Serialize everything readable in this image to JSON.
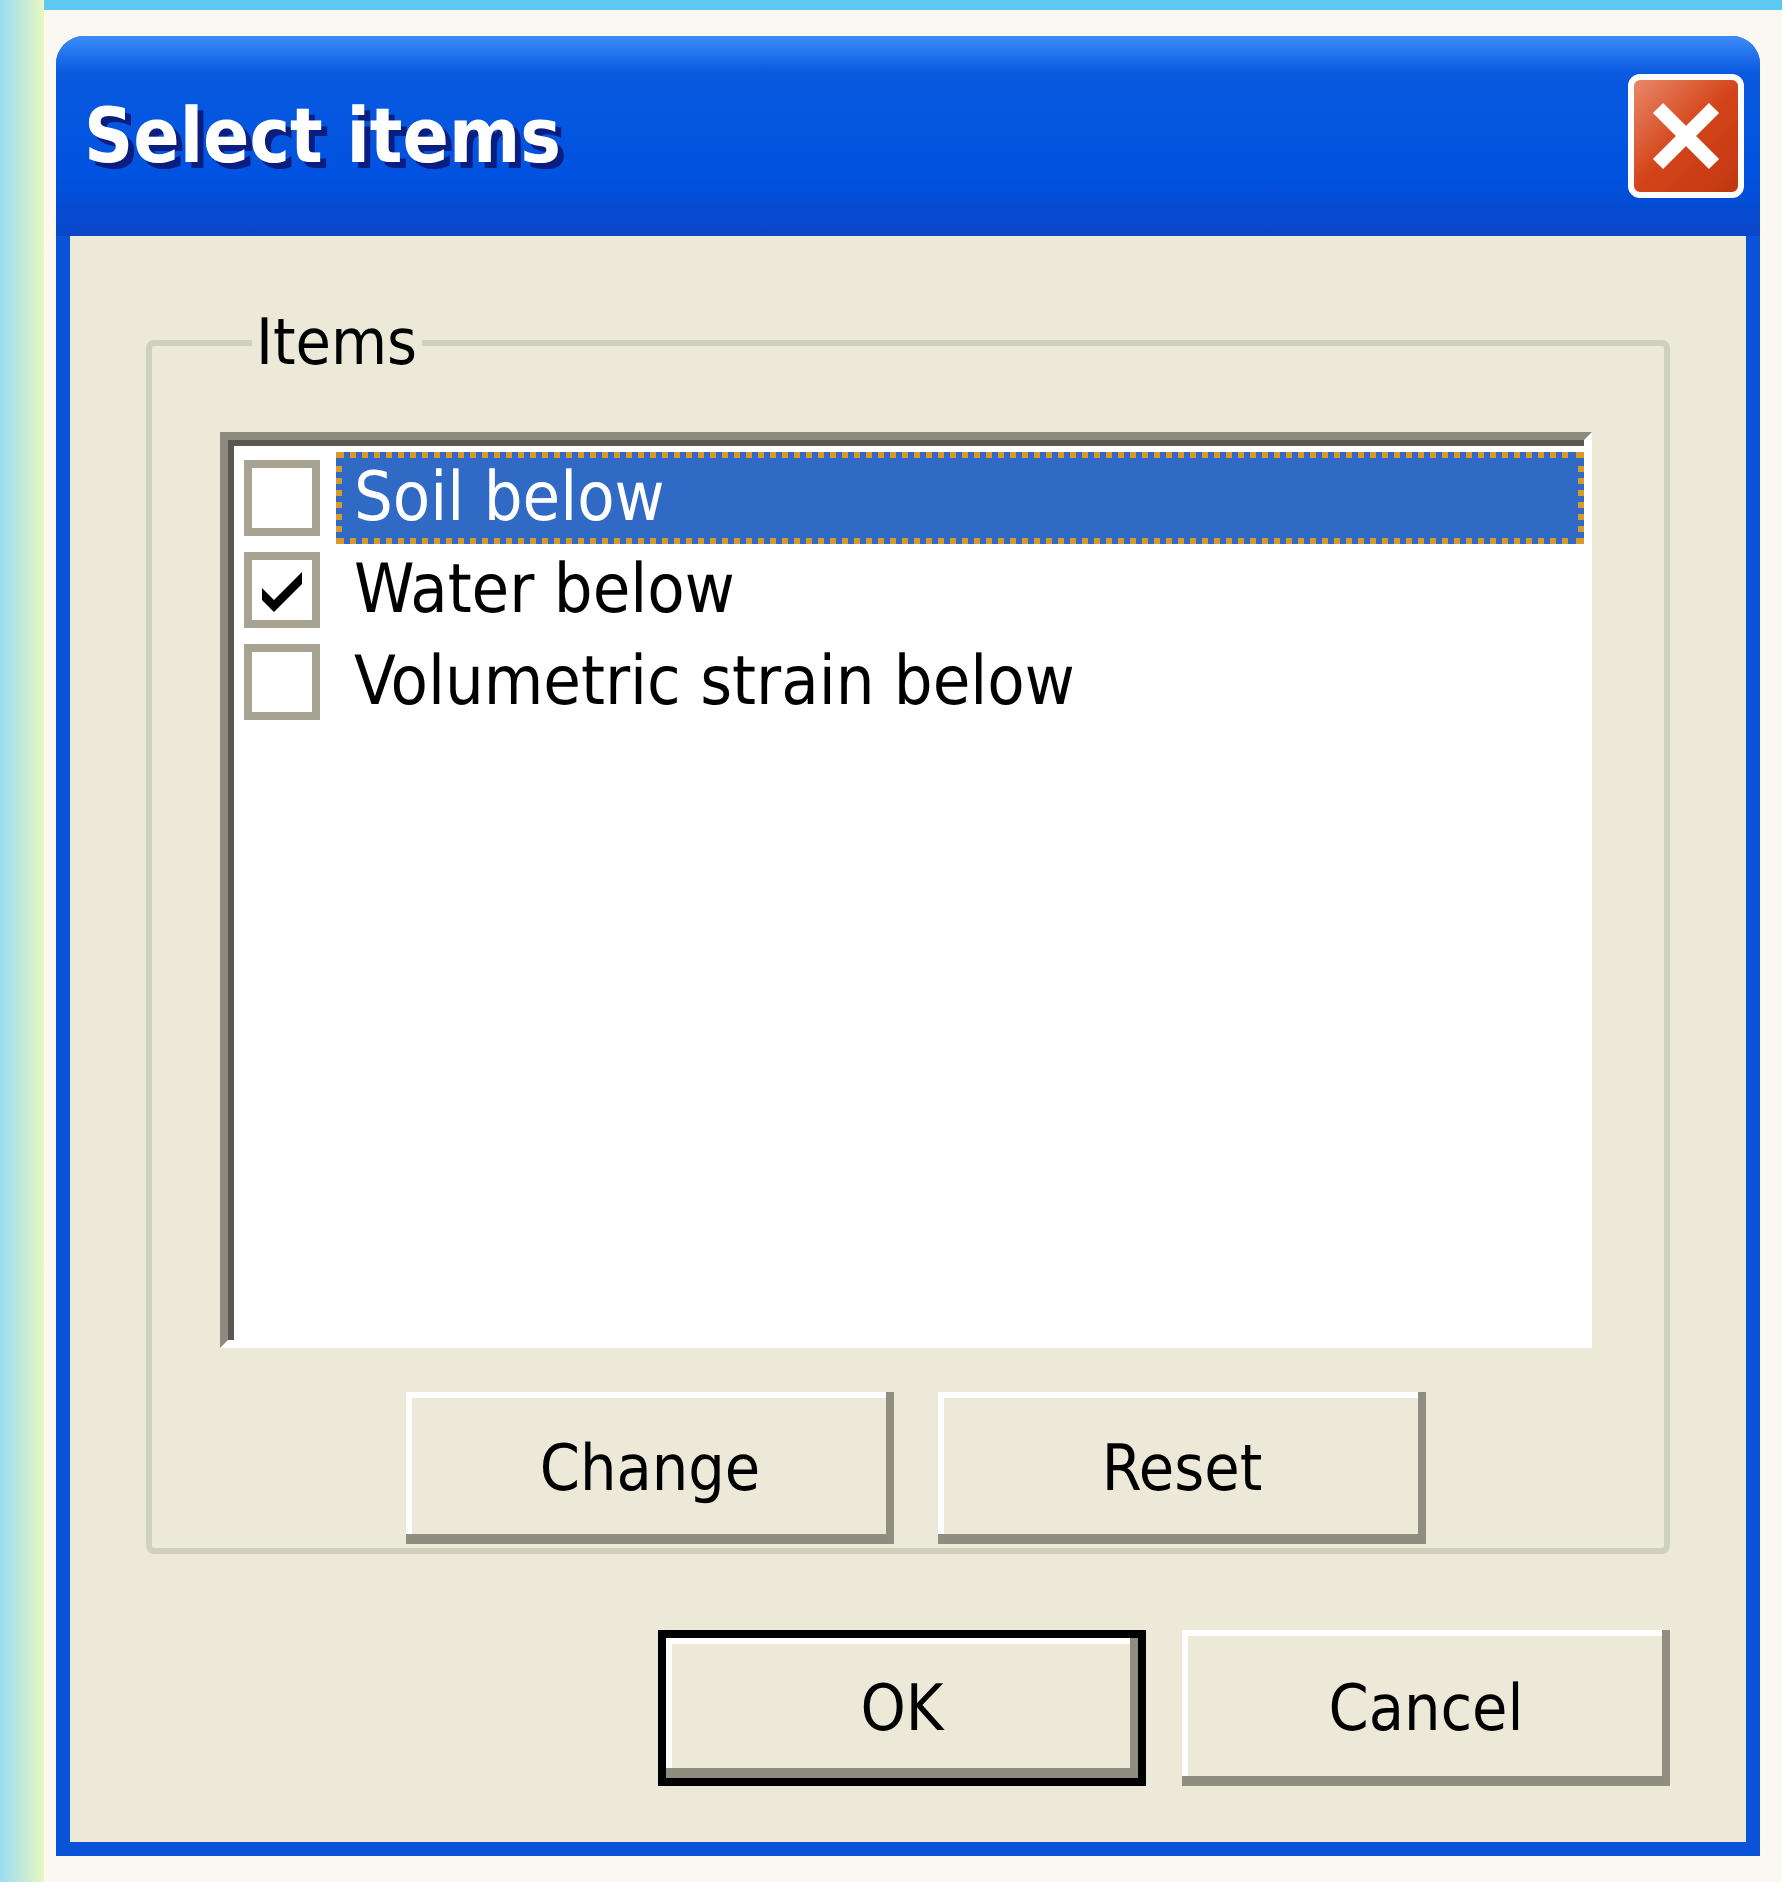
{
  "window": {
    "title": "Select items"
  },
  "group": {
    "label": "Items"
  },
  "items": [
    {
      "label": "Soil below",
      "checked": false,
      "selected": true
    },
    {
      "label": "Water below",
      "checked": true,
      "selected": false
    },
    {
      "label": "Volumetric strain below",
      "checked": false,
      "selected": false
    }
  ],
  "list_buttons": [
    {
      "label": "Change"
    },
    {
      "label": "Reset"
    }
  ],
  "dialog_buttons": [
    {
      "label": "OK",
      "default": true
    },
    {
      "label": "Cancel",
      "default": false
    }
  ]
}
